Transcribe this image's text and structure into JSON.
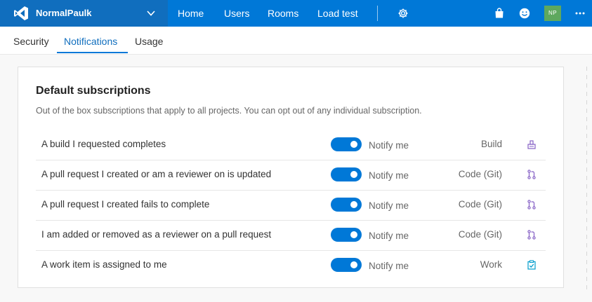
{
  "header": {
    "org_name": "NormalPaulk",
    "nav": [
      "Home",
      "Users",
      "Rooms",
      "Load test"
    ],
    "avatar_initials": "NP"
  },
  "tabs": [
    {
      "label": "Security",
      "active": false
    },
    {
      "label": "Notifications",
      "active": true
    },
    {
      "label": "Usage",
      "active": false
    }
  ],
  "section": {
    "title": "Default subscriptions",
    "description": "Out of the box subscriptions that apply to all projects. You can opt out of any individual subscription."
  },
  "subscriptions": [
    {
      "label": "A build I requested completes",
      "toggle_on": true,
      "toggle_label": "Notify me",
      "category": "Build",
      "icon": "build-icon"
    },
    {
      "label": "A pull request I created or am a reviewer on is updated",
      "toggle_on": true,
      "toggle_label": "Notify me",
      "category": "Code (Git)",
      "icon": "pull-request-icon"
    },
    {
      "label": "A pull request I created fails to complete",
      "toggle_on": true,
      "toggle_label": "Notify me",
      "category": "Code (Git)",
      "icon": "pull-request-icon"
    },
    {
      "label": "I am added or removed as a reviewer on a pull request",
      "toggle_on": true,
      "toggle_label": "Notify me",
      "category": "Code (Git)",
      "icon": "pull-request-icon"
    },
    {
      "label": "A work item is assigned to me",
      "toggle_on": true,
      "toggle_label": "Notify me",
      "category": "Work",
      "icon": "work-item-icon"
    }
  ],
  "colors": {
    "accent": "#0078d7",
    "brand_bg": "#106ebe",
    "avatar_bg": "#5ea85e",
    "icon_purple": "#8661c5",
    "icon_teal": "#009ccc"
  }
}
